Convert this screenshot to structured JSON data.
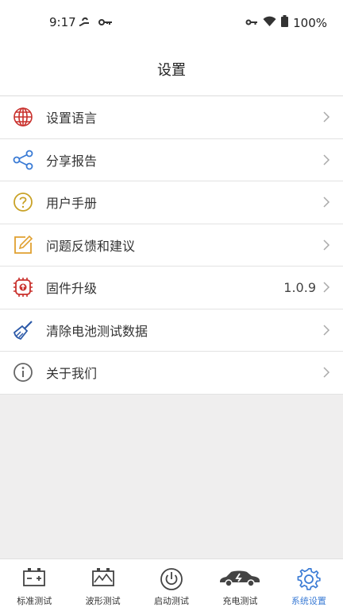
{
  "status": {
    "time": "9:17",
    "battery": "100%"
  },
  "header": {
    "title": "设置"
  },
  "menu": [
    {
      "label": "设置语言",
      "icon": "globe-icon"
    },
    {
      "label": "分享报告",
      "icon": "share-icon"
    },
    {
      "label": "用户手册",
      "icon": "help-icon"
    },
    {
      "label": "问题反馈和建议",
      "icon": "edit-icon"
    },
    {
      "label": "固件升级",
      "icon": "firmware-icon",
      "value": "1.0.9"
    },
    {
      "label": "清除电池测试数据",
      "icon": "broom-icon"
    },
    {
      "label": "关于我们",
      "icon": "info-icon"
    }
  ],
  "tabs": [
    {
      "label": "标准测试",
      "icon": "battery-icon",
      "active": false
    },
    {
      "label": "波形测试",
      "icon": "waveform-icon",
      "active": false
    },
    {
      "label": "启动测试",
      "icon": "power-icon",
      "active": false
    },
    {
      "label": "充电测试",
      "icon": "car-charge-icon",
      "active": false
    },
    {
      "label": "系统设置",
      "icon": "gear-icon",
      "active": true
    }
  ],
  "colors": {
    "accent": "#3a7bd5"
  }
}
